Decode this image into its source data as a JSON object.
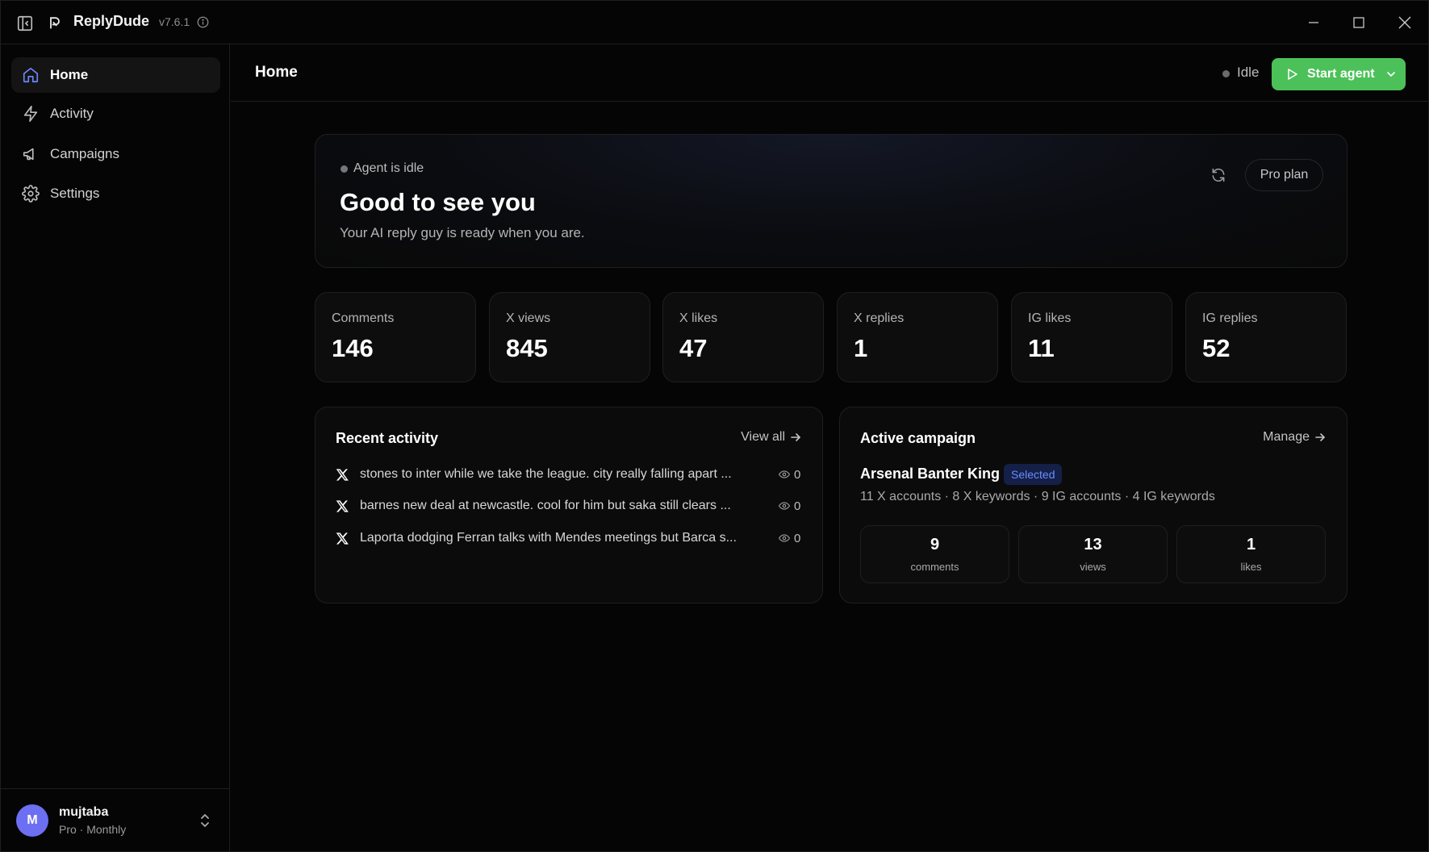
{
  "app": {
    "name": "ReplyDude",
    "version": "v7.6.1"
  },
  "sidebar": {
    "items": [
      {
        "label": "Home",
        "icon": "home-icon"
      },
      {
        "label": "Activity",
        "icon": "lightning-icon"
      },
      {
        "label": "Campaigns",
        "icon": "megaphone-icon"
      },
      {
        "label": "Settings",
        "icon": "gear-icon"
      }
    ]
  },
  "user": {
    "initial": "M",
    "name": "mujtaba",
    "plan": "Pro · Monthly"
  },
  "header": {
    "title": "Home",
    "status": "Idle",
    "start_label": "Start agent"
  },
  "hero": {
    "status": "Agent is idle",
    "title": "Good to see you",
    "subtitle": "Your AI reply guy is ready when you are.",
    "plan_label": "Pro plan"
  },
  "stats": [
    {
      "label": "Comments",
      "value": "146"
    },
    {
      "label": "X views",
      "value": "845"
    },
    {
      "label": "X likes",
      "value": "47"
    },
    {
      "label": "X replies",
      "value": "1"
    },
    {
      "label": "IG likes",
      "value": "11"
    },
    {
      "label": "IG replies",
      "value": "52"
    }
  ],
  "recent": {
    "title": "Recent activity",
    "link": "View all",
    "items": [
      {
        "text": "stones to inter while we take the league. city really falling apart ...",
        "views": "0"
      },
      {
        "text": "barnes new deal at newcastle. cool for him but saka still clears ...",
        "views": "0"
      },
      {
        "text": "Laporta dodging Ferran talks with Mendes meetings but Barca s...",
        "views": "0"
      }
    ]
  },
  "campaign": {
    "title": "Active campaign",
    "link": "Manage",
    "name": "Arsenal Banter King",
    "badge": "Selected",
    "meta": "11 X accounts · 8 X keywords · 9 IG accounts · 4 IG keywords",
    "stats": [
      {
        "value": "9",
        "label": "comments"
      },
      {
        "value": "13",
        "label": "views"
      },
      {
        "value": "1",
        "label": "likes"
      }
    ]
  },
  "colors": {
    "accent": "#6f86ff",
    "start_button": "#4cc15a",
    "avatar": "#6d6ff2",
    "badge_bg": "#142048",
    "badge_text": "#6d8cff"
  }
}
